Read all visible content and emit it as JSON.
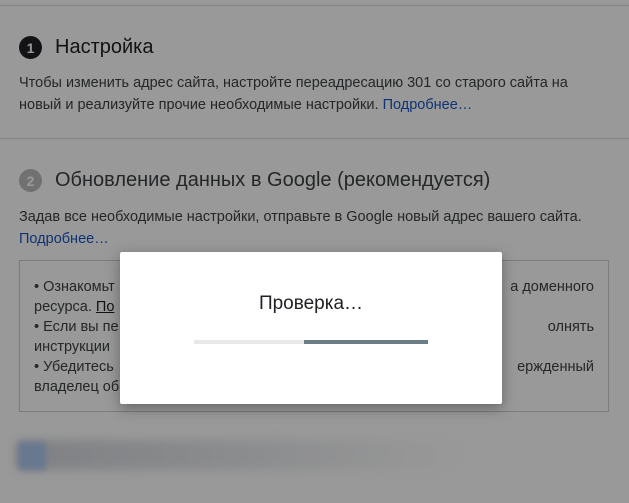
{
  "step1": {
    "number": "1",
    "title": "Настройка",
    "text": "Чтобы изменить адрес сайта, настройте переадресацию 301 со старого сайта на новый и реализуйте прочие необходимые настройки.",
    "link": "Подробнее…"
  },
  "step2": {
    "number": "2",
    "title": "Обновление данных в Google (рекомендуется)",
    "text": "Задав все необходимые настройки, отправьте в Google новый адрес вашего сайта.",
    "link": "Подробнее…"
  },
  "info_box": {
    "line1_a": "• Ознакомьт",
    "line1_b": "а доменного",
    "line2_a": "ресурса. ",
    "line2_link": "По",
    "line3_a": "• Если вы пе",
    "line3_b": "олнять",
    "line4_a": "инструкции",
    "line5_a": "• Убедитесь",
    "line5_b": "ержденный",
    "line6_a": "владелец об"
  },
  "dialog": {
    "title": "Проверка…",
    "progress_fraction": 0.53
  },
  "colors": {
    "link": "#1a56c4",
    "progress_fill": "#6b7d86",
    "progress_track": "#e8e8e8"
  }
}
